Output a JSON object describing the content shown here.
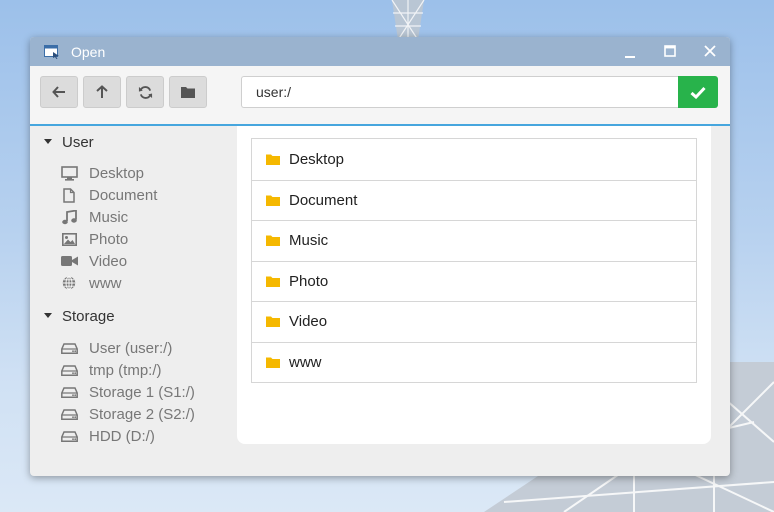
{
  "window": {
    "title": "Open",
    "app_icon": "window-icon",
    "controls": [
      "minimize-icon",
      "maximize-icon",
      "close-icon"
    ]
  },
  "toolbar": {
    "buttons": [
      "back-arrow-icon",
      "up-arrow-icon",
      "refresh-icon",
      "folder-icon"
    ],
    "path_value": "user:/",
    "confirm_icon": "check-icon"
  },
  "sidebar": {
    "groups": [
      {
        "label": "User",
        "items": [
          {
            "label": "Desktop",
            "icon": "monitor-icon"
          },
          {
            "label": "Document",
            "icon": "file-icon"
          },
          {
            "label": "Music",
            "icon": "music-note-icon"
          },
          {
            "label": "Photo",
            "icon": "image-icon"
          },
          {
            "label": "Video",
            "icon": "video-camera-icon"
          },
          {
            "label": "www",
            "icon": "globe-icon"
          }
        ]
      },
      {
        "label": "Storage",
        "items": [
          {
            "label": "User (user:/)",
            "icon": "drive-icon"
          },
          {
            "label": "tmp (tmp:/)",
            "icon": "drive-icon"
          },
          {
            "label": "Storage 1 (S1:/)",
            "icon": "drive-icon"
          },
          {
            "label": "Storage 2 (S2:/)",
            "icon": "drive-icon"
          },
          {
            "label": "HDD (D:/)",
            "icon": "drive-icon"
          }
        ]
      }
    ]
  },
  "files": [
    {
      "name": "Desktop",
      "icon": "folder-icon"
    },
    {
      "name": "Document",
      "icon": "folder-icon"
    },
    {
      "name": "Music",
      "icon": "folder-icon"
    },
    {
      "name": "Photo",
      "icon": "folder-icon"
    },
    {
      "name": "Video",
      "icon": "folder-icon"
    },
    {
      "name": "www",
      "icon": "folder-icon"
    }
  ],
  "colors": {
    "titlebar": "#9ab3cf",
    "accent_line": "#46a6de",
    "confirm": "#28b34b",
    "folder": "#f5b800"
  }
}
